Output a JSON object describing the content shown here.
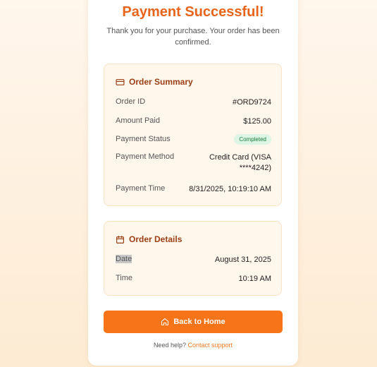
{
  "header": {
    "title": "Payment Successful!",
    "subtitle": "Thank you for your purchase. Your order has been confirmed."
  },
  "summary": {
    "title": "Order Summary",
    "icon": "credit-card-icon",
    "rows": [
      {
        "label": "Order ID",
        "value": "#ORD9724"
      },
      {
        "label": "Amount Paid",
        "value": "$125.00"
      },
      {
        "label": "Payment Status",
        "value": "Completed"
      },
      {
        "label": "Payment Method",
        "value": "Credit Card (VISA ****4242)"
      },
      {
        "label": "Payment Time",
        "value": "8/31/2025, 10:19:10 AM"
      }
    ]
  },
  "details": {
    "title": "Order Details",
    "icon": "calendar-icon",
    "rows": [
      {
        "label": "Date",
        "value": "August 31, 2025"
      },
      {
        "label": "Time",
        "value": "10:19 AM"
      }
    ]
  },
  "actions": {
    "back_home_label": "Back to Home",
    "back_home_icon": "home-icon"
  },
  "help": {
    "text": "Need help?",
    "link": "Contact support"
  },
  "colors": {
    "accent": "#f77418",
    "title": "#e8641b",
    "panel_title": "#9a3f14",
    "badge_bg": "#dcf5e4",
    "badge_text": "#1c7a3d"
  }
}
